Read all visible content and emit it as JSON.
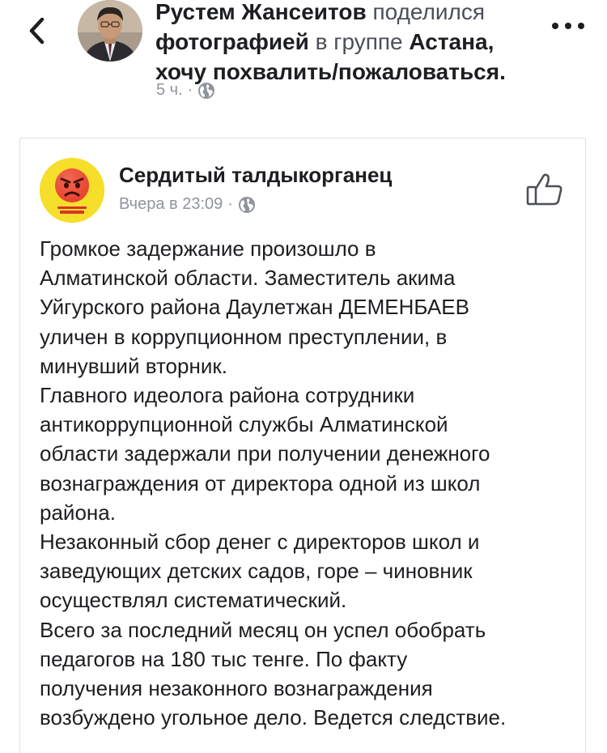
{
  "header": {
    "author": "Рустем Жансеитов",
    "action_text": " поделился ",
    "object": "фотографией",
    "group_prefix": " в группе ",
    "group_name": "Астана, хочу похвалить/пожаловаться.",
    "time": "5 ч.",
    "separator": "·",
    "privacy_icon": "globe-icon",
    "back_icon": "chevron-left-icon",
    "more_icon": "more-dots-icon"
  },
  "shared_post": {
    "page_name": "Сердитый талдыкорганец",
    "time": "Вчера в 23:09",
    "separator": "·",
    "privacy_icon": "globe-icon",
    "like_icon": "thumbs-up-icon",
    "body": "Громкое задержание произошло в\nАлматинской области. Заместитель акима\nУйгурского района Даулетжан ДЕМЕНБАЕВ\nуличен в коррупционном преступлении, в\nминувший вторник.\nГлавного идеолога района сотрудники\nантикоррупционной службы Алматинской\nобласти задержали при получении денежного\nвознаграждения от директора одной из школ\nрайона.\nНезаконный сбор денег с директоров школ и\nзаведующих детских садов, горе – чиновник\nосуществлял  систематический.\nВсего за последний месяц он успел обобрать\nпедагогов на 180 тыс тенге. По факту\nполучения незаконного вознаграждения\nвозбуждено угольное дело. Ведется следствие."
  }
}
